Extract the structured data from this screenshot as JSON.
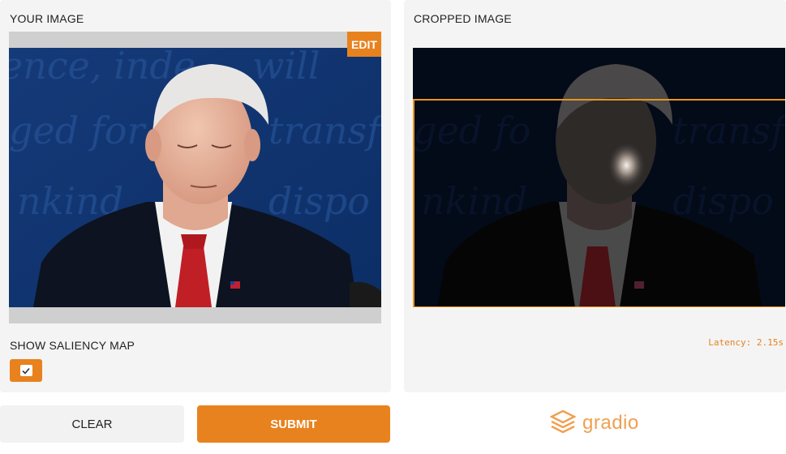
{
  "input_panel": {
    "title": "YOUR IMAGE",
    "edit_label": "EDIT",
    "saliency_label": "SHOW SALIENCY MAP",
    "saliency_checked": true,
    "image_alt": "Man in dark suit and red tie with eyes closed, blue background with script text"
  },
  "output_panel": {
    "title": "CROPPED IMAGE",
    "latency": "Latency: 2.15s",
    "image_alt": "Saliency-darkened image with orange crop rectangle"
  },
  "actions": {
    "clear_label": "CLEAR",
    "submit_label": "SUBMIT"
  },
  "footer": {
    "brand": "gradio"
  },
  "colors": {
    "accent": "#e8821e",
    "panel_bg": "#f4f4f4",
    "crop_box": "#e8951f"
  }
}
